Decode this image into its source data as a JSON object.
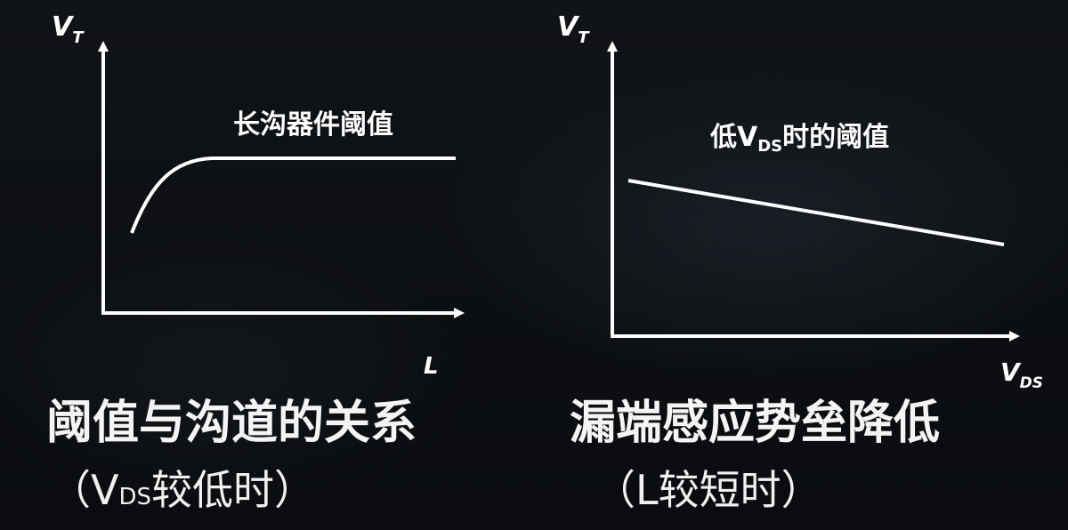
{
  "left_graph": {
    "y_axis_label": "V",
    "y_axis_subscript": "T",
    "x_axis_label": "L",
    "curve_label": "长沟器件阈值"
  },
  "right_graph": {
    "y_axis_label": "V",
    "y_axis_subscript": "T",
    "x_axis_label": "V",
    "x_axis_subscript": "DS",
    "line_label_prefix": "低",
    "line_label_v": "V",
    "line_label_sub": "DS",
    "line_label_suffix": "时的阈值"
  },
  "captions": {
    "left_title": "阈值与沟道的关系",
    "left_sub_open": "（V",
    "left_sub_small": "DS",
    "left_sub_rest": "较低时）",
    "right_title": "漏端感应势垒降低",
    "right_sub": "（L较短时）"
  },
  "colors": {
    "stroke": "#ffffff",
    "background": "#0b0d10"
  }
}
